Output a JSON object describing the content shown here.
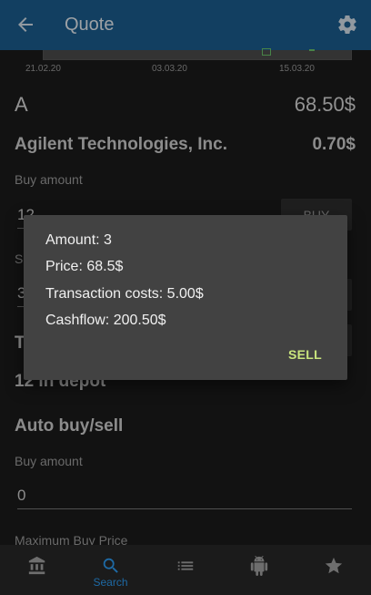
{
  "header": {
    "title": "Quote"
  },
  "chart": {
    "ticks": [
      "21.02.20",
      "03.03.20",
      "15.03.20"
    ]
  },
  "quote": {
    "symbol": "A",
    "price": "68.50$",
    "company": "Agilent Technologies, Inc.",
    "change": "0.70$"
  },
  "trade": {
    "buy_label": "Buy amount",
    "buy_value": "12",
    "buy_button": "BUY",
    "sell_label_partial": "Se",
    "sell_value": "3",
    "t_label_partial": "T",
    "depot_text": "12 in depot"
  },
  "auto": {
    "title": "Auto buy/sell",
    "buy_amount_label": "Buy amount",
    "buy_amount_value": "0",
    "max_price_label": "Maximum Buy Price"
  },
  "dialog": {
    "amount": "Amount: 3",
    "price": "Price: 68.5$",
    "costs": "Transaction costs: 5.00$",
    "cashflow": "Cashflow: 200.50$",
    "action": "SELL"
  },
  "nav": {
    "items": [
      {
        "icon": "bank-icon",
        "label": ""
      },
      {
        "icon": "search-icon",
        "label": "Search"
      },
      {
        "icon": "list-icon",
        "label": ""
      },
      {
        "icon": "android-icon",
        "label": ""
      },
      {
        "icon": "star-icon",
        "label": ""
      }
    ],
    "active_color": "#1e6aa5",
    "inactive_color": "#8a8a8a"
  },
  "colors": {
    "appbar": "#1b5e8f",
    "accent": "#c9e57d",
    "background": "#1b1b1b"
  }
}
